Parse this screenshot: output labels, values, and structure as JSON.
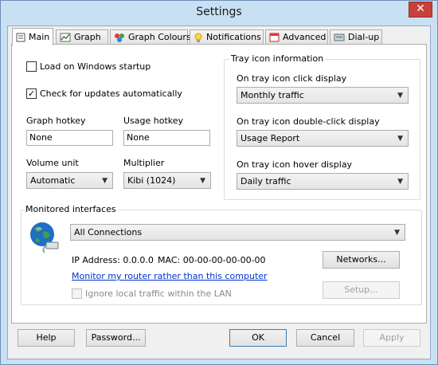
{
  "window": {
    "title": "Settings",
    "close_glyph": "✕"
  },
  "tabs": [
    {
      "label": "Main",
      "icon": "settings-page-icon"
    },
    {
      "label": "Graph",
      "icon": "graph-icon"
    },
    {
      "label": "Graph Colours",
      "icon": "palette-icon"
    },
    {
      "label": "Notifications",
      "icon": "lightbulb-icon"
    },
    {
      "label": "Advanced",
      "icon": "calendar-icon"
    },
    {
      "label": "Dial-up",
      "icon": "dialup-icon"
    }
  ],
  "main": {
    "load_startup": {
      "label": "Load on Windows startup",
      "checked": false
    },
    "check_updates": {
      "label": "Check for updates automatically",
      "checked": true
    },
    "graph_hotkey": {
      "label": "Graph hotkey",
      "value": "None"
    },
    "usage_hotkey": {
      "label": "Usage hotkey",
      "value": "None"
    },
    "volume_unit": {
      "label": "Volume unit",
      "value": "Automatic"
    },
    "multiplier": {
      "label": "Multiplier",
      "value": "Kibi (1024)"
    }
  },
  "tray": {
    "legend": "Tray icon information",
    "click": {
      "label": "On tray icon click display",
      "value": "Monthly traffic"
    },
    "double_click": {
      "label": "On tray icon double-click display",
      "value": "Usage Report"
    },
    "hover": {
      "label": "On tray icon hover display",
      "value": "Daily traffic"
    }
  },
  "monitored": {
    "legend": "Monitored interfaces",
    "interface": "All Connections",
    "ip": "IP Address: 0.0.0.0",
    "mac": "MAC: 00-00-00-00-00-00",
    "networks_button": "Networks...",
    "router_link": "Monitor my router rather than this computer",
    "setup_button": "Setup...",
    "ignore_lan": {
      "label": "Ignore local traffic within the LAN",
      "checked": false
    }
  },
  "footer": {
    "help": "Help",
    "password": "Password...",
    "ok": "OK",
    "cancel": "Cancel",
    "apply": "Apply"
  },
  "colors": {
    "titlebar": "#c9dff3",
    "close": "#c7413a",
    "link": "#0033cc"
  }
}
